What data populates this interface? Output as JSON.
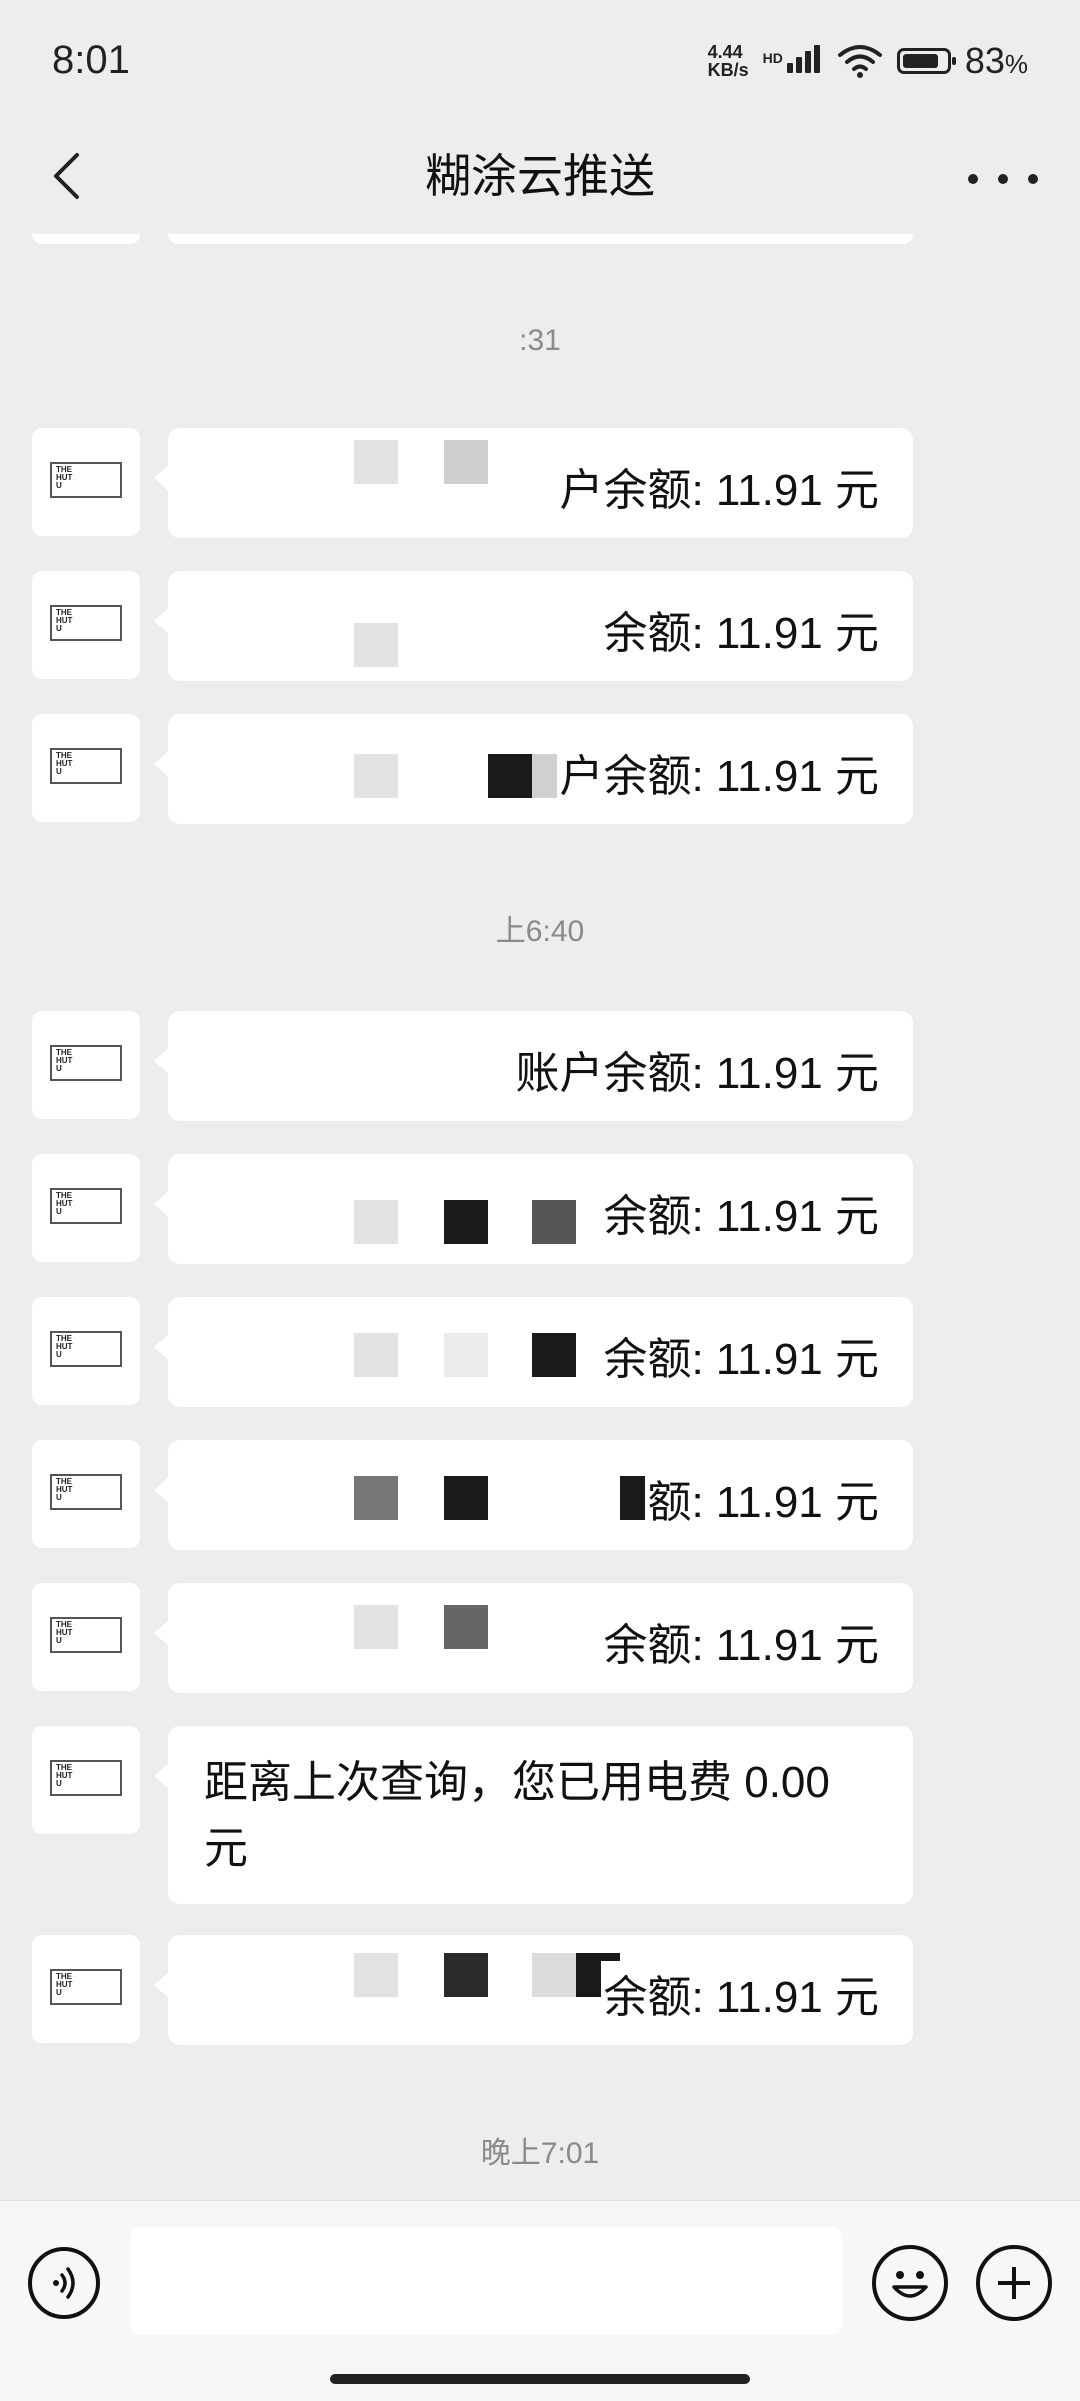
{
  "status_bar": {
    "time": "8:01",
    "net_speed_value": "4.44",
    "net_speed_unit": "KB/s",
    "network_badge": "HD",
    "battery_percent": "83",
    "battery_unit": "%",
    "battery_level": 0.83
  },
  "header": {
    "title": "糊涂云推送"
  },
  "avatar": {
    "logo_lines": [
      "THE",
      "HUT",
      "U"
    ]
  },
  "chat": {
    "time_separators": [
      ":31",
      "上6:40",
      "晚上7:01"
    ],
    "messages": [
      {
        "text": "户余额: 11.91 元"
      },
      {
        "text": "余额: 11.91 元"
      },
      {
        "text": "户余额: 11.91 元"
      },
      {
        "text": "账户余额: 11.91 元"
      },
      {
        "text": "余额: 11.91 元"
      },
      {
        "text": "余额: 11.91 元"
      },
      {
        "text": "额: 11.91 元"
      },
      {
        "text": "余额: 11.91 元"
      },
      {
        "text": "距离上次查询，您已用电费 0.00 元"
      },
      {
        "text": "余额: 11.91 元"
      }
    ]
  },
  "input_bar": {
    "placeholder": ""
  }
}
